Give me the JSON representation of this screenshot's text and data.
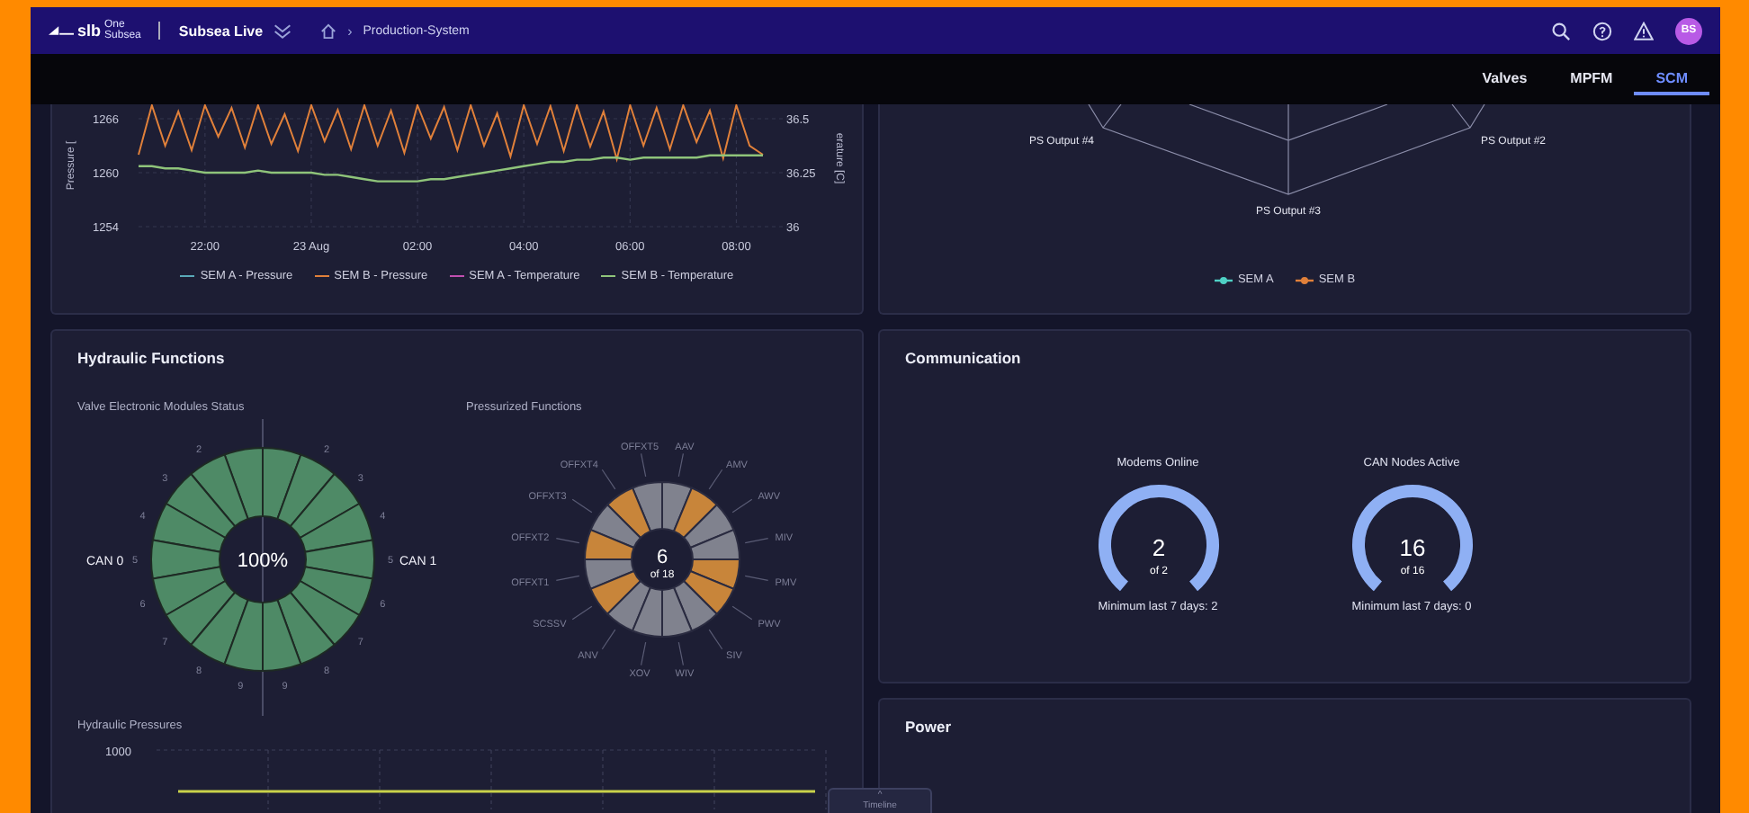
{
  "header": {
    "logo_mark": "slb",
    "logo_text": [
      "One",
      "Subsea"
    ],
    "app_name": "Subsea Live",
    "breadcrumb_separator": "›",
    "breadcrumb": "Production-System",
    "avatar": "BS"
  },
  "tabs": [
    {
      "label": "Valves",
      "selected": false
    },
    {
      "label": "MPFM",
      "selected": false
    },
    {
      "label": "SCM",
      "selected": true
    }
  ],
  "pressure_panel": {
    "chart_data": {
      "type": "line",
      "grid": true,
      "ylabel": "Pressure [",
      "y2label": "erature [C]",
      "ylim": [
        1254,
        1267.6
      ],
      "y2lim": [
        36,
        36.5667
      ],
      "yticks": [
        1254,
        1260,
        1266
      ],
      "y2ticks": [
        36,
        36.25,
        36.5
      ],
      "categories": [
        null,
        null,
        null,
        null,
        null,
        "22:00",
        null,
        null,
        null,
        null,
        null,
        null,
        null,
        "23 Aug",
        null,
        null,
        null,
        null,
        null,
        null,
        null,
        "02:00",
        null,
        null,
        null,
        null,
        null,
        null,
        null,
        "04:00",
        null,
        null,
        null,
        null,
        null,
        null,
        null,
        "06:00",
        null,
        null,
        null,
        null,
        null,
        null,
        null,
        "08:00",
        null,
        null
      ],
      "series": [
        {
          "name": "SEM A - Pressure",
          "color": "#5aa9b8",
          "values": [
            null,
            null,
            null,
            null,
            null,
            null,
            null,
            null,
            null,
            null,
            null,
            null,
            null,
            null,
            null,
            null,
            null,
            null,
            null,
            null,
            null,
            null,
            null,
            null,
            null,
            null,
            null,
            null,
            null,
            null,
            null,
            null,
            null,
            null,
            null,
            null,
            null,
            null,
            null,
            null,
            null,
            null,
            null,
            null,
            null,
            null,
            null,
            null
          ]
        },
        {
          "name": "SEM B - Pressure",
          "color": "#e0803a",
          "values": [
            1262,
            1267.5,
            1263,
            1266.8,
            1262.5,
            1267.5,
            1264,
            1267.2,
            1262.8,
            1267.5,
            1263.2,
            1266.5,
            1262.4,
            1267.5,
            1263.5,
            1267,
            1262.6,
            1267.5,
            1263,
            1266.9,
            1262.2,
            1267.5,
            1263.8,
            1267.3,
            1262.5,
            1267.5,
            1263,
            1266.6,
            1261.8,
            1267.5,
            1263.2,
            1267.4,
            1262.4,
            1267.5,
            1262.9,
            1266.8,
            1261.5,
            1267.5,
            1263,
            1267.2,
            1262.6,
            1267.5,
            1263.4,
            1266.9,
            1261.6,
            1267.5,
            1263,
            1262
          ]
        },
        {
          "name": "SEM A - Temperature",
          "color": "#c04fb0",
          "values": [
            null,
            null,
            null,
            null,
            null,
            null,
            null,
            null,
            null,
            null,
            null,
            null,
            null,
            null,
            null,
            null,
            null,
            null,
            null,
            null,
            null,
            null,
            null,
            null,
            null,
            null,
            null,
            null,
            null,
            null,
            null,
            null,
            null,
            null,
            null,
            null,
            null,
            null,
            null,
            null,
            null,
            null,
            null,
            null,
            null,
            null,
            null,
            null
          ]
        },
        {
          "name": "SEM B - Temperature",
          "color": "#8fc47a",
          "axis": "y2",
          "values": [
            36.28,
            36.28,
            36.27,
            36.27,
            36.26,
            36.25,
            36.25,
            36.25,
            36.25,
            36.26,
            36.25,
            36.25,
            36.25,
            36.25,
            36.24,
            36.24,
            36.23,
            36.22,
            36.21,
            36.21,
            36.21,
            36.21,
            36.22,
            36.22,
            36.23,
            36.24,
            36.25,
            36.26,
            36.27,
            36.28,
            36.29,
            36.3,
            36.3,
            36.31,
            36.31,
            36.32,
            36.32,
            36.31,
            36.32,
            36.32,
            36.32,
            36.32,
            36.32,
            36.33,
            36.33,
            36.33,
            36.33,
            36.33
          ]
        }
      ]
    }
  },
  "radar_panel": {
    "axis_labels": [
      "PS Output #4",
      "PS Output #2",
      "PS Output #3"
    ],
    "legend": [
      {
        "name": "SEM A",
        "color": "#4fd1c5"
      },
      {
        "name": "SEM B",
        "color": "#e0803a"
      }
    ]
  },
  "hydraulic": {
    "title": "Hydraulic Functions",
    "vem": {
      "title": "Valve Electronic Modules Status",
      "center": "100%",
      "left_label": "CAN 0",
      "right_label": "CAN 1",
      "left_segments": [
        {
          "ok": true
        },
        {
          "label": "2",
          "ok": true
        },
        {
          "label": "3",
          "ok": true
        },
        {
          "label": "4",
          "ok": true
        },
        {
          "label": "5",
          "ok": true
        },
        {
          "label": "6",
          "ok": true
        },
        {
          "label": "7",
          "ok": true
        },
        {
          "label": "8",
          "ok": true
        },
        {
          "label": "9",
          "ok": true
        }
      ],
      "right_segments": [
        {
          "ok": true
        },
        {
          "label": "2",
          "ok": true
        },
        {
          "label": "3",
          "ok": true
        },
        {
          "label": "4",
          "ok": true
        },
        {
          "label": "5",
          "ok": true
        },
        {
          "label": "6",
          "ok": true
        },
        {
          "label": "7",
          "ok": true
        },
        {
          "label": "8",
          "ok": true
        },
        {
          "label": "9",
          "ok": true
        }
      ]
    },
    "pressurized": {
      "title": "Pressurized Functions",
      "count": "6",
      "of": "of 18",
      "functions": [
        {
          "label": "AAV",
          "pressurized": false
        },
        {
          "label": "AMV",
          "pressurized": true
        },
        {
          "label": "AWV",
          "pressurized": false
        },
        {
          "label": "MIV",
          "pressurized": false
        },
        {
          "label": "PMV",
          "pressurized": true
        },
        {
          "label": "PWV",
          "pressurized": true
        },
        {
          "label": "SIV",
          "pressurized": false
        },
        {
          "label": "WIV",
          "pressurized": false
        },
        {
          "label": "OFFXT5",
          "pressurized": false
        },
        {
          "label": "OFFXT4",
          "pressurized": true
        },
        {
          "label": "OFFXT3",
          "pressurized": false
        },
        {
          "label": "OFFXT2",
          "pressurized": true
        },
        {
          "label": "OFFXT1",
          "pressurized": false
        },
        {
          "label": "SCSSV",
          "pressurized": true
        },
        {
          "label": "ANV",
          "pressurized": false
        },
        {
          "label": "XOV",
          "pressurized": false
        }
      ]
    },
    "pressures": {
      "title": "Hydraulic Pressures",
      "tick_label": "1000"
    }
  },
  "communication": {
    "title": "Communication",
    "gauges": [
      {
        "title": "Modems Online",
        "value": "2",
        "of": "of 2",
        "level": 1,
        "minimum": "Minimum last 7 days:  2"
      },
      {
        "title": "CAN Nodes Active",
        "value": "16",
        "of": "of 16",
        "level": 1,
        "minimum": "Minimum last 7 days:  0"
      }
    ]
  },
  "power": {
    "title": "Power"
  },
  "timeline": {
    "caret": "^",
    "label": "Timeline"
  }
}
